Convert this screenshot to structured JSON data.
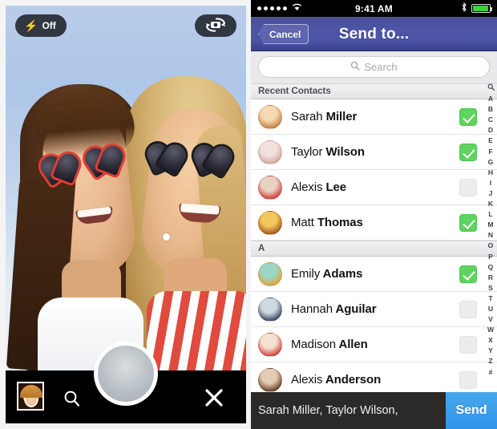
{
  "camera": {
    "flash_label": "Off",
    "flash_icon": "lightning-bolt-icon",
    "flip_icon": "camera-flip-icon",
    "thumbnail_name": "gallery-thumbnail",
    "search_icon": "search-icon",
    "shutter_name": "shutter-button",
    "close_icon": "close-x-icon"
  },
  "phone": {
    "status": {
      "signal": "•••••",
      "wifi_icon": "wifi-icon",
      "time": "9:41 AM",
      "bluetooth_icon": "bluetooth-icon",
      "battery_icon": "battery-icon"
    },
    "nav": {
      "cancel_label": "Cancel",
      "title": "Send to..."
    },
    "search": {
      "placeholder": "Search",
      "value": "",
      "icon": "search-icon"
    },
    "sections": [
      {
        "title": "Recent Contacts",
        "contacts": [
          {
            "first": "Sarah",
            "last": "Miller",
            "checked": true,
            "avatar_colors": [
              "#f6d9b0",
              "#c9834a"
            ]
          },
          {
            "first": "Taylor",
            "last": "Wilson",
            "checked": true,
            "avatar_colors": [
              "#f2e2dd",
              "#d8a9a0"
            ]
          },
          {
            "first": "Alexis",
            "last": "Lee",
            "checked": false,
            "avatar_colors": [
              "#e8d2c2",
              "#d8413c"
            ]
          },
          {
            "first": "Matt",
            "last": "Thomas",
            "checked": true,
            "avatar_colors": [
              "#f2c75c",
              "#a75a22"
            ]
          }
        ]
      },
      {
        "title": "A",
        "contacts": [
          {
            "first": "Emily",
            "last": "Adams",
            "checked": true,
            "avatar_colors": [
              "#9bd7c4",
              "#e8a23c"
            ]
          },
          {
            "first": "Hannah",
            "last": "Aguilar",
            "checked": false,
            "avatar_colors": [
              "#cfd9e2",
              "#3c4b63"
            ]
          },
          {
            "first": "Madison",
            "last": "Allen",
            "checked": false,
            "avatar_colors": [
              "#f3e2cf",
              "#d8443e"
            ]
          },
          {
            "first": "Alexis",
            "last": "Anderson",
            "checked": false,
            "avatar_colors": [
              "#e3cbb4",
              "#6b4226"
            ]
          }
        ]
      }
    ],
    "index_letters": [
      "A",
      "B",
      "C",
      "D",
      "E",
      "F",
      "G",
      "H",
      "I",
      "J",
      "K",
      "L",
      "M",
      "N",
      "O",
      "P",
      "Q",
      "R",
      "S",
      "T",
      "U",
      "V",
      "W",
      "X",
      "Y",
      "Z",
      "#"
    ],
    "index_search_icon": "search-icon",
    "footer": {
      "recipients": "Sarah Miller, Taylor Wilson, ",
      "send_label": "Send"
    }
  },
  "colors": {
    "accent_green": "#5fd35f",
    "send_blue": "#2f93e8",
    "navbar_purple": "#4e55a8"
  }
}
